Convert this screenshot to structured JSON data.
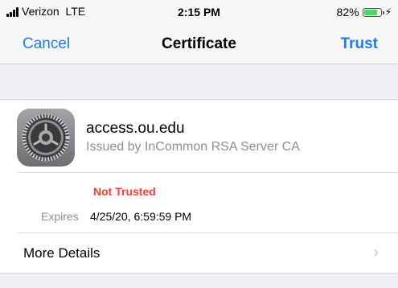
{
  "status_bar": {
    "carrier": "Verizon  LTE",
    "time": "2:15 PM",
    "battery_percent": "82%",
    "battery_level": 0.82,
    "charging_icon": "bolt-icon"
  },
  "nav": {
    "left_button": "Cancel",
    "title": "Certificate",
    "right_button": "Trust"
  },
  "certificate": {
    "icon": "settings-gear-icon",
    "name": "access.ou.edu",
    "issuer": "Issued by InCommon RSA Server CA",
    "status": "Not Trusted",
    "expires_label": "Expires",
    "expires_value": "4/25/20, 6:59:59 PM"
  },
  "details": {
    "label": "More Details",
    "chevron_icon": "chevron-right-icon"
  },
  "colors": {
    "accent": "#1a7bf2",
    "danger": "#ff3b30",
    "battery": "#4cd964",
    "background": "#efeff4"
  }
}
